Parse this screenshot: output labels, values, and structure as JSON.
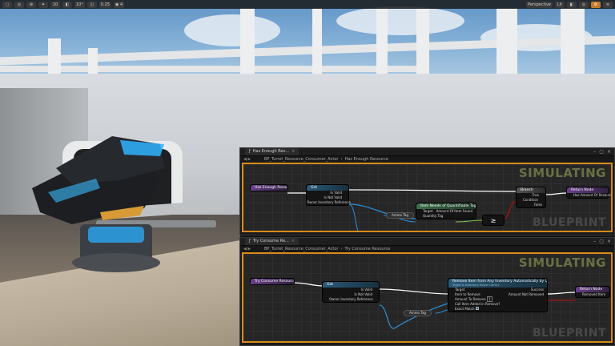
{
  "toolbar": {
    "left_buttons": [
      "▢",
      "◎",
      "⊕",
      "✦",
      "10",
      "◧",
      "10°",
      "◫",
      "0.25",
      "◉ 4"
    ],
    "viewport_mode": "Perspective",
    "lit_mode": "Lit",
    "right_buttons": [
      "◧",
      "◎",
      "⚙",
      "≡"
    ]
  },
  "windows": [
    {
      "tab_title": "Has Enough Res...",
      "breadcrumb": [
        "BP_Turret_Resource_Consumer_Actor",
        "Has Enough Resource"
      ],
      "simulating_label": "SIMULATING",
      "watermark": "BLUEPRINT",
      "nodes": {
        "entry": "Has Enough Resource?",
        "cast": "Get",
        "cast_pins": [
          "In Valid",
          "Is Not Valid",
          "Owner Inventory Reference"
        ],
        "query": "Item Needs of Quantifiable Tag (by Inventory Ref)",
        "query_pins_left": [
          "Target",
          "Quantity Tag"
        ],
        "query_pins_right": [
          "Amount Of Item Found"
        ],
        "tag": "Ammo Tag",
        "compare": "≥",
        "branch": "Branch",
        "branch_pins": [
          "Condition",
          "True",
          "False"
        ],
        "return": "Return Node",
        "return_pins": [
          "Has Amount Of Resource Found"
        ]
      }
    },
    {
      "tab_title": "Try Consume Re...",
      "breadcrumb": [
        "BP_Turret_Resource_Consumer_Actor",
        "Try Consume Resource"
      ],
      "simulating_label": "SIMULATING",
      "watermark": "BLUEPRINT",
      "nodes": {
        "entry": "Try Consume Resource",
        "cast": "Get",
        "cast_pins": [
          "Is Valid",
          "Is Not Valid",
          "Owner Inventory Reference"
        ],
        "tag": "Ammo Tag",
        "remove": "Remove Item from Any Inventory Automatically by Quantity Tag",
        "remove_subtitle": "Target is Inventory Helper Library",
        "remove_pins_left": [
          "Target",
          "Item to Remove",
          "Amount To Remove",
          "Call Item Added in Remove?",
          "Exact Match"
        ],
        "amount_value": "1",
        "remove_pins_right": [
          "Success",
          "Amount Not Removed"
        ],
        "return": "Return Node",
        "return_pins": [
          "Removed Item"
        ]
      }
    }
  ],
  "colors": {
    "accent_border": "#d98a1a",
    "exec_wire": "#ffffff",
    "object_wire": "#2e8fd6",
    "bool_wire": "#a21414",
    "sim_text": "#6a7043"
  }
}
